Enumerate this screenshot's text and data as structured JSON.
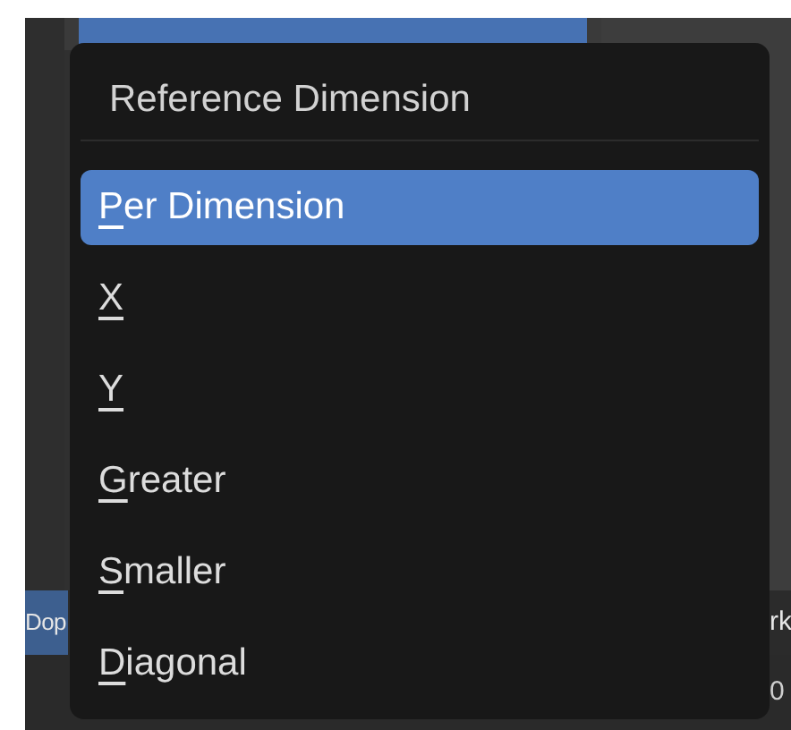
{
  "header": {
    "editor": "Dop",
    "menu": "rk"
  },
  "timeline": {
    "tick": "0"
  },
  "menu": {
    "title": "Reference Dimension",
    "items": [
      {
        "label": "Per Dimension",
        "mnemonic": true,
        "selected": true
      },
      {
        "label": "X",
        "mnemonic": true,
        "selected": false
      },
      {
        "label": "Y",
        "mnemonic": true,
        "selected": false
      },
      {
        "label": "Greater",
        "mnemonic": true,
        "selected": false
      },
      {
        "label": "Smaller",
        "mnemonic": true,
        "selected": false
      },
      {
        "label": "Diagonal",
        "mnemonic": true,
        "selected": false
      }
    ]
  }
}
